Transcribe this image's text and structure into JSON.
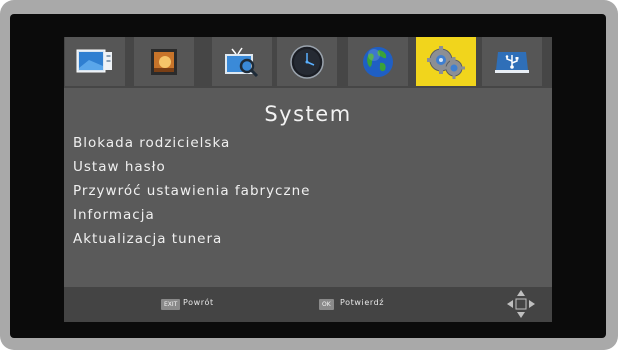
{
  "menu": {
    "title": "System",
    "items": [
      {
        "label": "Blokada rodzicielska"
      },
      {
        "label": "Ustaw hasło"
      },
      {
        "label": "Przywróć ustawienia fabryczne"
      },
      {
        "label": "Informacja"
      },
      {
        "label": "Aktualizacja tunera"
      }
    ]
  },
  "tabs": [
    {
      "icon": "picture-settings-icon",
      "active": false
    },
    {
      "icon": "photo-media-icon",
      "active": false
    },
    {
      "icon": "channel-search-icon",
      "active": false
    },
    {
      "icon": "clock-icon",
      "active": false
    },
    {
      "icon": "globe-icon",
      "active": false
    },
    {
      "icon": "system-gears-icon",
      "active": true
    },
    {
      "icon": "usb-icon",
      "active": false
    }
  ],
  "footer": {
    "exit_key": "EXIT",
    "exit_label": "Powrót",
    "ok_key": "OK",
    "ok_label": "Potwierdź",
    "navigation_icon": "dpad-navigation-icon"
  },
  "colors": {
    "active_tab": "#f1d51c",
    "panel": "#5a5a5a",
    "tab": "#565656"
  }
}
